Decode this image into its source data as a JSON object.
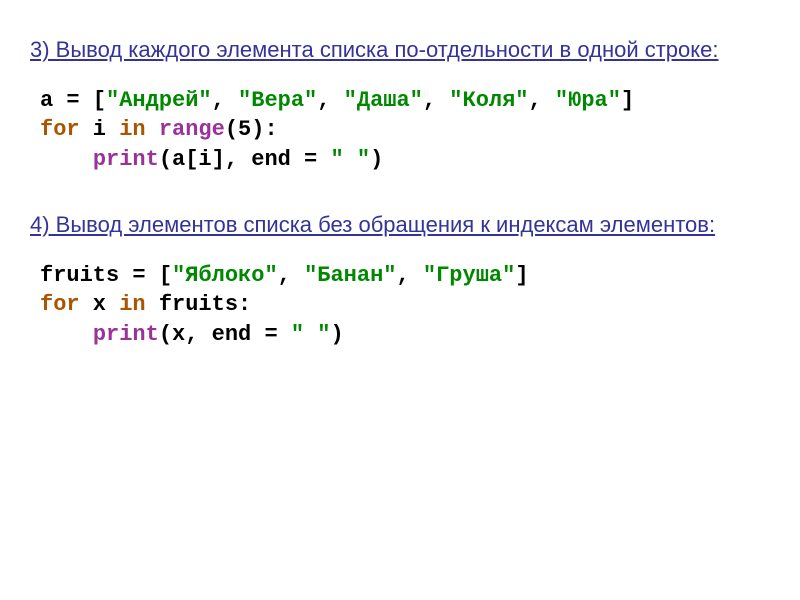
{
  "heading3": "3) Вывод каждого элемента списка по-отдельности в одной строке:",
  "heading4": "4) Вывод элементов списка без обращения к индексам элементов:",
  "code3": {
    "l1_p1": "a = [",
    "l1_s1": "\"Андрей\"",
    "l1_c1": ", ",
    "l1_s2": "\"Вера\"",
    "l1_c2": ", ",
    "l1_s3": "\"Даша\"",
    "l1_c3": ", ",
    "l1_s4": "\"Коля\"",
    "l1_c4": ", ",
    "l1_s5": "\"Юра\"",
    "l1_p2": "]",
    "l2_kw1": "for",
    "l2_p1": " i ",
    "l2_kw2": "in",
    "l2_p2": " ",
    "l2_fn": "range",
    "l2_p3": "(",
    "l2_num": "5",
    "l2_p4": "):",
    "l3_indent": "    ",
    "l3_fn": "print",
    "l3_p1": "(a[i], end = ",
    "l3_str": "\" \"",
    "l3_p2": ")"
  },
  "code4": {
    "l1_p1": "fruits = [",
    "l1_s1": "\"Яблоко\"",
    "l1_c1": ", ",
    "l1_s2": "\"Банан\"",
    "l1_c2": ", ",
    "l1_s3": "\"Груша\"",
    "l1_p2": "]",
    "l2_kw1": "for",
    "l2_p1": " x ",
    "l2_kw2": "in",
    "l2_p2": " fruits:",
    "l3_indent": "    ",
    "l3_fn": "print",
    "l3_p1": "(x, end = ",
    "l3_str": "\" \"",
    "l3_p2": ")"
  }
}
